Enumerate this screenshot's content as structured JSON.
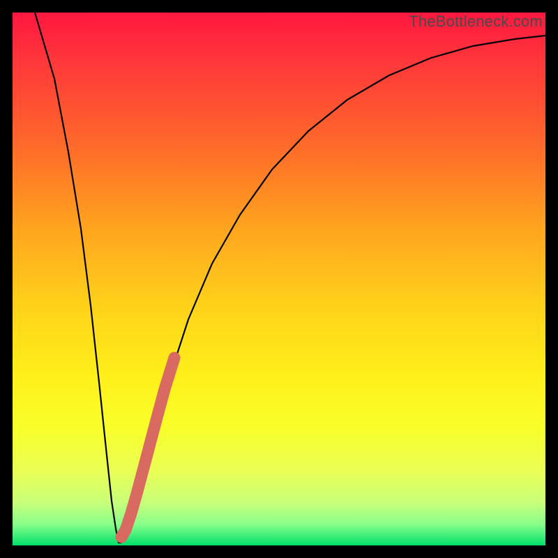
{
  "watermark": "TheBottleneck.com",
  "colors": {
    "frame": "#000000",
    "curve": "#000000",
    "highlight": "#d86a62",
    "gradient_top": "#ff1740",
    "gradient_bottom": "#00e06a"
  },
  "chart_data": {
    "type": "line",
    "title": "",
    "xlabel": "",
    "ylabel": "",
    "xlim": [
      0,
      100
    ],
    "ylim": [
      0,
      100
    ],
    "x": [
      3,
      5,
      7,
      9,
      11,
      13,
      15,
      17,
      18,
      19,
      20,
      22,
      25,
      30,
      35,
      40,
      45,
      50,
      55,
      60,
      65,
      70,
      75,
      80,
      85,
      90,
      95,
      100
    ],
    "values": [
      100,
      88,
      74,
      60,
      46,
      32,
      18,
      6,
      2,
      0,
      3,
      12,
      25,
      42,
      55,
      65,
      73,
      79,
      83,
      86,
      89,
      91,
      92.5,
      93.5,
      94.3,
      95,
      95.5,
      96
    ],
    "series": [
      {
        "name": "bottleneck-curve",
        "x": [
          3,
          5,
          7,
          9,
          11,
          13,
          15,
          17,
          18,
          19,
          20,
          22,
          25,
          30,
          35,
          40,
          45,
          50,
          55,
          60,
          65,
          70,
          75,
          80,
          85,
          90,
          95,
          100
        ],
        "values": [
          100,
          88,
          74,
          60,
          46,
          32,
          18,
          6,
          2,
          0,
          3,
          12,
          25,
          42,
          55,
          65,
          73,
          79,
          83,
          86,
          89,
          91,
          92.5,
          93.5,
          94.3,
          95,
          95.5,
          96
        ]
      },
      {
        "name": "highlight-segment",
        "x": [
          19,
          20,
          22,
          25,
          28,
          30
        ],
        "values": [
          0,
          3,
          12,
          25,
          36,
          42
        ]
      }
    ],
    "annotations": []
  }
}
